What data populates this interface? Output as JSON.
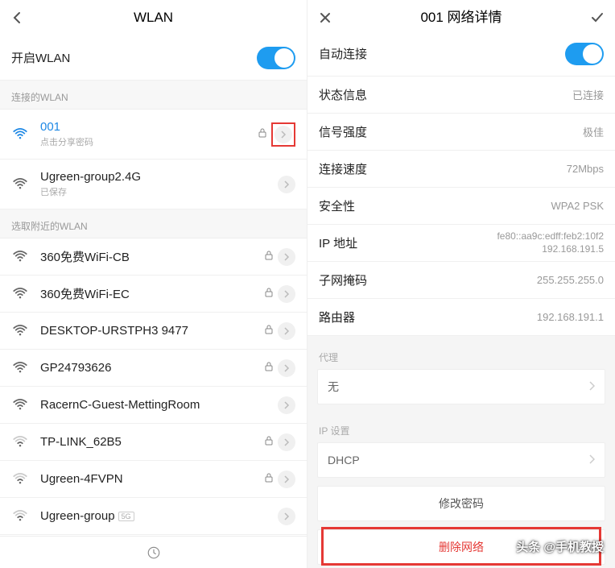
{
  "left": {
    "header": {
      "back_icon": "‹",
      "title": "WLAN"
    },
    "enable_row": {
      "label": "开启WLAN",
      "on": true
    },
    "connected_section": "连接的WLAN",
    "connected": [
      {
        "name": "001",
        "sub": "点击分享密码",
        "locked": true,
        "active": true,
        "highlight_chevron": true
      },
      {
        "name": "Ugreen-group2.4G",
        "sub": "已保存",
        "locked": false,
        "active": false
      }
    ],
    "nearby_section": "选取附近的WLAN",
    "nearby": [
      {
        "name": "360免费WiFi-CB",
        "locked": true
      },
      {
        "name": "360免费WiFi-EC",
        "locked": true
      },
      {
        "name": "DESKTOP-URSTPH3 9477",
        "locked": true
      },
      {
        "name": "GP24793626",
        "locked": true
      },
      {
        "name": "RacernC-Guest-MettingRoom",
        "locked": false
      },
      {
        "name": "TP-LINK_62B5",
        "locked": true
      },
      {
        "name": "Ugreen-4FVPN",
        "locked": true
      },
      {
        "name": "Ugreen-group",
        "locked": false,
        "badge": "5G"
      }
    ]
  },
  "right": {
    "header": {
      "close": "×",
      "title": "001 网络详情",
      "confirm": "✓"
    },
    "auto_connect": {
      "label": "自动连接",
      "on": true
    },
    "details": [
      {
        "label": "状态信息",
        "value": "已连接"
      },
      {
        "label": "信号强度",
        "value": "极佳"
      },
      {
        "label": "连接速度",
        "value": "72Mbps"
      },
      {
        "label": "安全性",
        "value": "WPA2 PSK"
      },
      {
        "label": "IP 地址",
        "value": "fe80::aa9c:edff:feb2:10f2\n192.168.191.5",
        "multi": true
      },
      {
        "label": "子网掩码",
        "value": "255.255.255.0"
      },
      {
        "label": "路由器",
        "value": "192.168.191.1"
      }
    ],
    "proxy_label": "代理",
    "proxy_value": "无",
    "ip_settings_label": "IP 设置",
    "ip_settings_value": "DHCP",
    "change_pw": "修改密码",
    "delete_net": "删除网络"
  },
  "watermark": "头条 @手机教授"
}
